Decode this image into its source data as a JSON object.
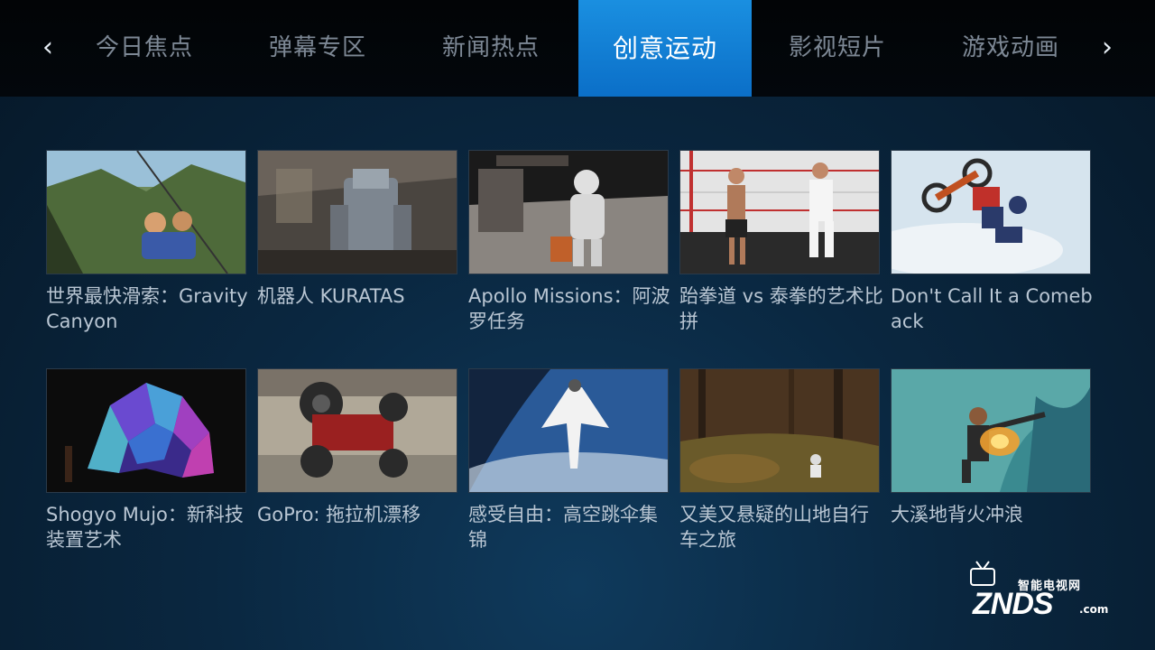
{
  "nav": {
    "left_arrow": "‹",
    "right_arrow": "›",
    "tabs": [
      {
        "label": "今日焦点",
        "active": false
      },
      {
        "label": "弹幕专区",
        "active": false
      },
      {
        "label": "新闻热点",
        "active": false
      },
      {
        "label": "创意运动",
        "active": true
      },
      {
        "label": "影视短片",
        "active": false
      },
      {
        "label": "游戏动画",
        "active": false
      }
    ]
  },
  "videos": [
    {
      "title": "世界最快滑索：Gravity Canyon",
      "thumb": "zipline-icon"
    },
    {
      "title": "机器人 KURATAS",
      "thumb": "robot-icon"
    },
    {
      "title": "Apollo Missions：阿波罗任务",
      "thumb": "astronaut-icon"
    },
    {
      "title": "跆拳道 vs 泰拳的艺术比拼",
      "thumb": "martial-arts-icon"
    },
    {
      "title": "Don't Call It a Comeback",
      "thumb": "motocross-icon"
    },
    {
      "title": "Shogyo Mujo：新科技装置艺术",
      "thumb": "art-installation-icon"
    },
    {
      "title": "GoPro: 拖拉机漂移",
      "thumb": "tractor-icon"
    },
    {
      "title": "感受自由：高空跳伞集锦",
      "thumb": "wingsuit-icon"
    },
    {
      "title": "又美又悬疑的山地自行车之旅",
      "thumb": "mountain-bike-icon"
    },
    {
      "title": "大溪地背火冲浪",
      "thumb": "surfing-icon"
    }
  ],
  "watermark": {
    "top_text": "智能电视网",
    "logo": "ZNDS",
    "suffix": ".com"
  },
  "colors": {
    "accent": "#0b7fd8",
    "background": "#0a2740",
    "topbar": "#020406"
  }
}
